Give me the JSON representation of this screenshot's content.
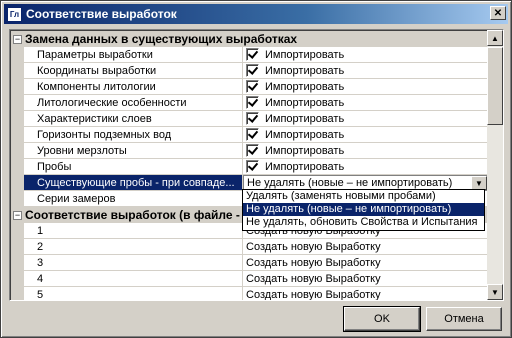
{
  "window": {
    "title": "Соответствие выработок",
    "icon_text": "Гл",
    "close_label": "✕"
  },
  "sections": [
    {
      "label": "Замена данных в существующих выработках",
      "toggle": "−",
      "rows": [
        {
          "name": "Параметры выработки",
          "value": "Импортировать",
          "checked": true
        },
        {
          "name": "Координаты выработки",
          "value": "Импортировать",
          "checked": true
        },
        {
          "name": "Компоненты литологии",
          "value": "Импортировать",
          "checked": true
        },
        {
          "name": "Литологические особенности",
          "value": "Импортировать",
          "checked": true
        },
        {
          "name": "Характеристики слоев",
          "value": "Импортировать",
          "checked": true
        },
        {
          "name": "Горизонты подземных вод",
          "value": "Импортировать",
          "checked": true
        },
        {
          "name": "Уровни мерзлоты",
          "value": "Импортировать",
          "checked": true
        },
        {
          "name": "Пробы",
          "value": "Импортировать",
          "checked": true
        }
      ],
      "combo_row": {
        "name": "Существующие пробы - при совпаде...",
        "value": "Не удалять (новые – не импортировать)",
        "button": "▼"
      },
      "last_row": {
        "name": "Серии замеров"
      }
    },
    {
      "label": "Соответствие выработок (в файле - ",
      "toggle": "−",
      "rows": [
        {
          "name": "1",
          "value": "Создать новую Выработку"
        },
        {
          "name": "2",
          "value": "Создать новую Выработку"
        },
        {
          "name": "3",
          "value": "Создать новую Выработку"
        },
        {
          "name": "4",
          "value": "Создать новую Выработку"
        },
        {
          "name": "5",
          "value": "Создать новую Выработку"
        }
      ]
    }
  ],
  "dropdown": {
    "options": [
      "Удалять (заменять новыми пробами)",
      "Не удалять (новые – не импортировать)",
      "Не удалять, обновить Свойства и Испытания"
    ],
    "highlighted_index": 1
  },
  "scrollbar": {
    "up": "▲",
    "down": "▼"
  },
  "buttons": {
    "ok": "OK",
    "cancel": "Отмена"
  }
}
